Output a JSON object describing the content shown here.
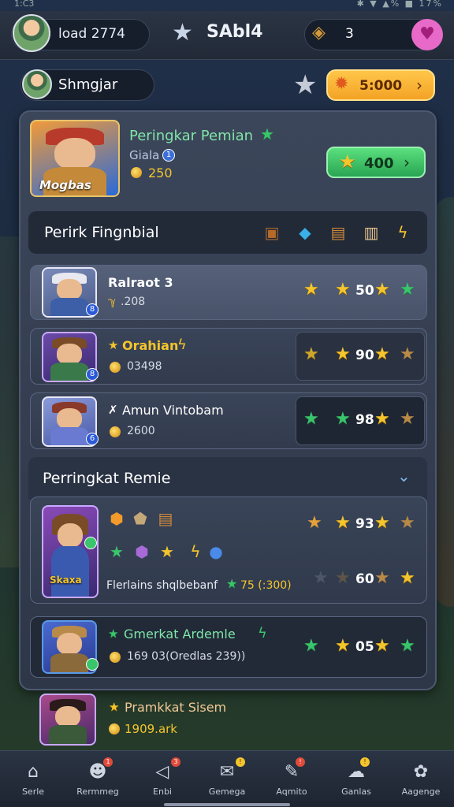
{
  "status": {
    "left": "1:C3",
    "right": "✱ ▼ ▲% ■ 17%"
  },
  "topbar": {
    "player_name": "load 2774",
    "title": "SAbl4",
    "currency_value": "3"
  },
  "subbar": {
    "name": "Shmgjar",
    "gold_value": "5:000"
  },
  "hero": {
    "title": "Peringkar Pemian",
    "subtitle": "Giala",
    "subtitle_badge": "1",
    "coins": "250",
    "button_label": "400",
    "portrait_label": "Mogbas"
  },
  "section1": {
    "title": "Perirk Fingnbial"
  },
  "rows": [
    {
      "name": "Ralraot 3",
      "sub_prefix": "ℽ",
      "sub": ".208",
      "score": "50",
      "badge": "8"
    },
    {
      "name": "Orahian",
      "name_prefix": "★",
      "sub": "03498",
      "score": "90",
      "badge": "8"
    },
    {
      "name": "Amun Vintobam",
      "name_prefix": "✗",
      "sub": "2600",
      "score": "98",
      "badge": "6"
    }
  ],
  "section2": {
    "title": "Perringkat Remie",
    "featured": {
      "score_top": "93",
      "score_bottom": "60",
      "bottom_text": "Flerlains shqlbebanf",
      "bottom_value": "75 (:300)",
      "portrait_label": "Skaxa"
    },
    "card": {
      "name": "Gmerkat Ardemle",
      "sub": "169 03(Oredlas 239))",
      "score": "05"
    }
  },
  "bottom_row": {
    "name": "Pramkkat Sisem",
    "sub": "1909.ark"
  },
  "nav": [
    {
      "label": "Serle",
      "icon": "house-icon",
      "glyph": "⌂",
      "badge": ""
    },
    {
      "label": "Rermmeg",
      "icon": "character-icon",
      "glyph": "☻",
      "badge": "1"
    },
    {
      "label": "Enbi",
      "icon": "flag-icon",
      "glyph": "◁",
      "badge": "3"
    },
    {
      "label": "Gemega",
      "icon": "mail-icon",
      "glyph": "✉",
      "badge": "!"
    },
    {
      "label": "Aqmito",
      "icon": "compass-icon",
      "glyph": "✎",
      "badge": "!"
    },
    {
      "label": "Ganlas",
      "icon": "chat-icon",
      "glyph": "☁",
      "badge": "!"
    },
    {
      "label": "Aagenge",
      "icon": "gear-icon",
      "glyph": "✿",
      "badge": ""
    }
  ],
  "colors": {
    "accent_green": "#3ac46b",
    "gold": "#f4c52c",
    "orange_button": "#f3a325",
    "pink_button": "#e86ac8"
  }
}
